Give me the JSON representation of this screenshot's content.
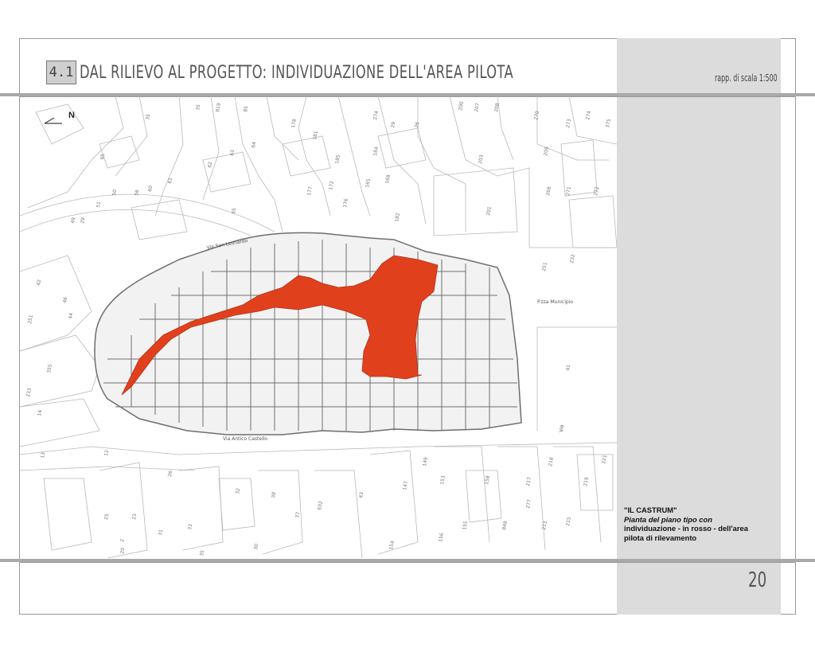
{
  "header": {
    "section_number": "4.1",
    "title": "Dal rilievo al progetto: individuazione dell'area pilota",
    "scale": "rapp. di scala 1:500"
  },
  "map": {
    "north_label": "N",
    "streets": {
      "san_leonardo": "Via San Leonardo",
      "antico_castello": "Via Antico Castello",
      "piazza": "P.zza Municipio",
      "via": "Via"
    },
    "parcels": [
      "35",
      "819",
      "85",
      "200",
      "207",
      "208",
      "29",
      "26",
      "35",
      "178",
      "274",
      "270",
      "273",
      "274",
      "375",
      "95",
      "62",
      "63",
      "64",
      "181",
      "185",
      "184",
      "203",
      "209",
      "50",
      "61",
      "60",
      "56",
      "177",
      "172",
      "165",
      "168",
      "268",
      "271",
      "272",
      "29",
      "49",
      "51",
      "65",
      "176",
      "182",
      "201",
      "251",
      "232",
      "42",
      "46",
      "44",
      "251",
      "41",
      "233",
      "355",
      "14",
      "13",
      "12",
      "26",
      "32",
      "38",
      "37",
      "632",
      "43",
      "147",
      "149",
      "153",
      "158",
      "217",
      "218",
      "219",
      "221",
      "25",
      "23",
      "30",
      "31",
      "2",
      "20",
      "33",
      "35",
      "154",
      "155",
      "156",
      "215",
      "213",
      "277",
      "848"
    ],
    "highlight_color": "#e1401d"
  },
  "caption": {
    "heading": "\"IL CASTRUM\"",
    "line1": "Pianta del piano tipo con",
    "line2": "individuazione - in rosso - dell'area",
    "line3": "pilota di rilevamento"
  },
  "page_number": "20"
}
